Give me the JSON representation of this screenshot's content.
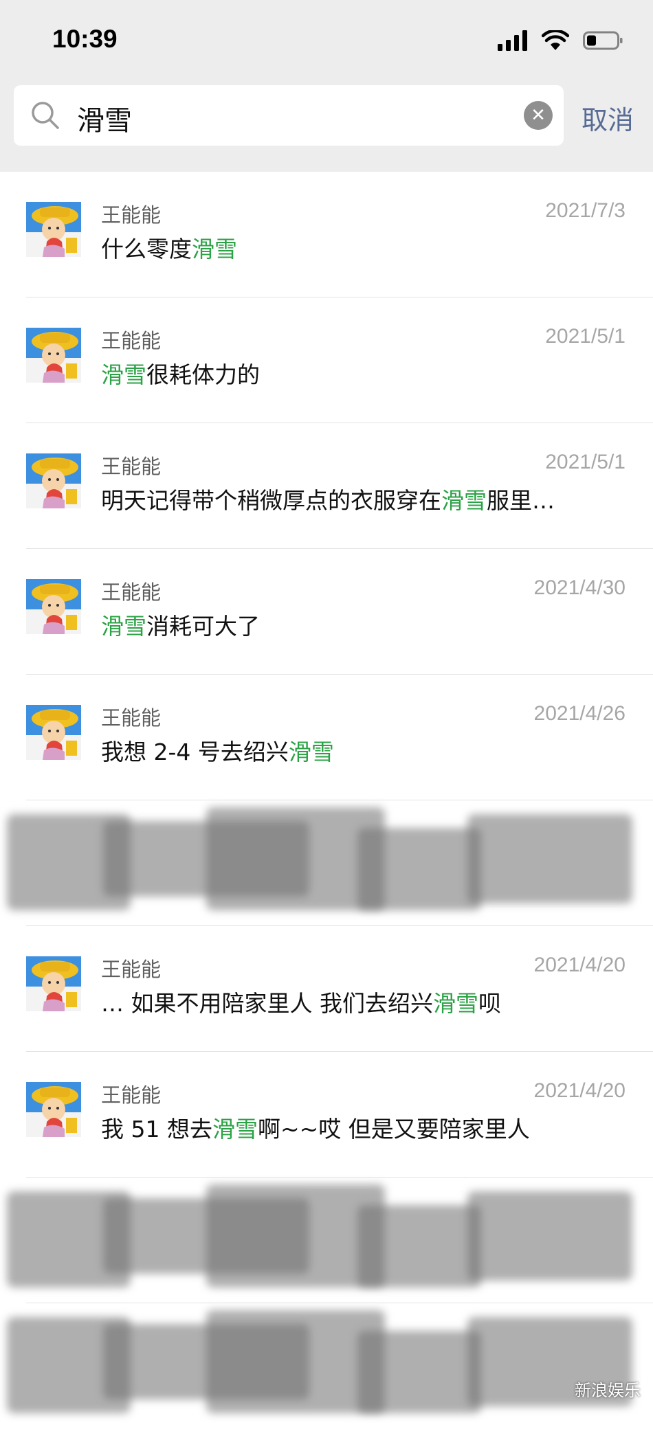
{
  "status_bar": {
    "time": "10:39"
  },
  "search": {
    "query": "滑雪",
    "cancel_label": "取消"
  },
  "results": [
    {
      "sender": "王能能",
      "date": "2021/7/3",
      "parts": [
        {
          "t": "什么零度"
        },
        {
          "t": "滑雪",
          "hl": true
        }
      ]
    },
    {
      "sender": "王能能",
      "date": "2021/5/1",
      "parts": [
        {
          "t": "滑雪",
          "hl": true
        },
        {
          "t": "很耗体力的"
        }
      ]
    },
    {
      "sender": "王能能",
      "date": "2021/5/1",
      "parts": [
        {
          "t": "明天记得带个稍微厚点的衣服穿在"
        },
        {
          "t": "滑雪",
          "hl": true
        },
        {
          "t": "服里…"
        }
      ]
    },
    {
      "sender": "王能能",
      "date": "2021/4/30",
      "parts": [
        {
          "t": "滑雪",
          "hl": true
        },
        {
          "t": "消耗可大了"
        }
      ]
    },
    {
      "sender": "王能能",
      "date": "2021/4/26",
      "parts": [
        {
          "t": "我想 2-4 号去绍兴"
        },
        {
          "t": "滑雪",
          "hl": true
        }
      ]
    },
    {
      "redacted": true
    },
    {
      "sender": "王能能",
      "date": "2021/4/20",
      "parts": [
        {
          "t": "… 如果不用陪家里人 我们去绍兴"
        },
        {
          "t": "滑雪",
          "hl": true
        },
        {
          "t": "呗"
        }
      ]
    },
    {
      "sender": "王能能",
      "date": "2021/4/20",
      "parts": [
        {
          "t": "我 51 想去"
        },
        {
          "t": "滑雪",
          "hl": true
        },
        {
          "t": "啊~~哎 但是又要陪家里人"
        }
      ]
    },
    {
      "redacted": true
    },
    {
      "redacted": true
    }
  ],
  "watermark": {
    "text": "新浪娱乐"
  },
  "colors": {
    "highlight": "#2ba245",
    "cancel": "#576b95",
    "header_bg": "#ededed"
  }
}
